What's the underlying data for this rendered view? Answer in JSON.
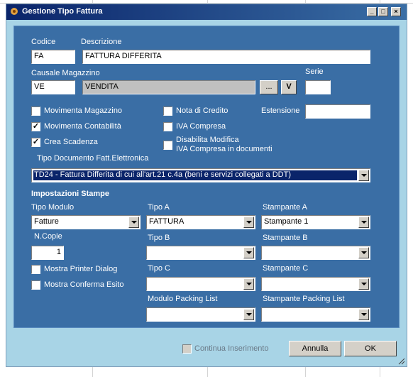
{
  "window": {
    "title": "Gestione Tipo Fattura"
  },
  "fields": {
    "codice": {
      "label": "Codice",
      "value": "FA"
    },
    "descrizione": {
      "label": "Descrizione",
      "value": "FATTURA DIFFERITA"
    },
    "causale": {
      "label": "Causale Magazzino",
      "code": "VE",
      "desc": "VENDITA",
      "browse": "...",
      "v": "V"
    },
    "serie": {
      "label": "Serie",
      "value": ""
    },
    "estensione": {
      "label": "Estensione",
      "value": ""
    }
  },
  "checks": {
    "movimenta_magazzino": {
      "label": "Movimenta Magazzino",
      "checked": false
    },
    "movimenta_contabilita": {
      "label": "Movimenta Contabilità",
      "checked": true
    },
    "crea_scadenza": {
      "label": "Crea Scadenza",
      "checked": true
    },
    "nota_credito": {
      "label": "Nota di Credito",
      "checked": false
    },
    "iva_compresa": {
      "label": "IVA Compresa",
      "checked": false
    },
    "disabilita_line1": "Disabilita  Modifica",
    "disabilita_line2": "IVA Compresa in documenti"
  },
  "tipo_doc": {
    "label": "Tipo Documento Fatt.Elettronica",
    "value": "TD24 - Fattura Differita di cui all'art.21 c.4a (beni e servizi collegati a DDT)"
  },
  "stampe": {
    "header": "Impostazioni Stampe",
    "tipo_modulo": {
      "label": "Tipo Modulo",
      "value": "Fatture"
    },
    "tipo_a": {
      "label": "Tipo A",
      "value": "FATTURA"
    },
    "stampante_a": {
      "label": "Stampante A",
      "value": "Stampante 1"
    },
    "ncopie": {
      "label": "N.Copie",
      "value": "1"
    },
    "tipo_b": {
      "label": "Tipo B",
      "value": ""
    },
    "stampante_b": {
      "label": "Stampante B",
      "value": ""
    },
    "mostra_printer": {
      "label": "Mostra Printer Dialog",
      "checked": false
    },
    "tipo_c": {
      "label": "Tipo C",
      "value": ""
    },
    "stampante_c": {
      "label": "Stampante C",
      "value": ""
    },
    "mostra_conferma": {
      "label": "Mostra Conferma Esito",
      "checked": false
    },
    "modulo_packing": {
      "label": "Modulo Packing List",
      "value": ""
    },
    "stampante_packing": {
      "label": "Stampante Packing List",
      "value": ""
    }
  },
  "footer": {
    "continua": "Continua Inserimento",
    "annulla": "Annulla",
    "ok": "OK"
  }
}
